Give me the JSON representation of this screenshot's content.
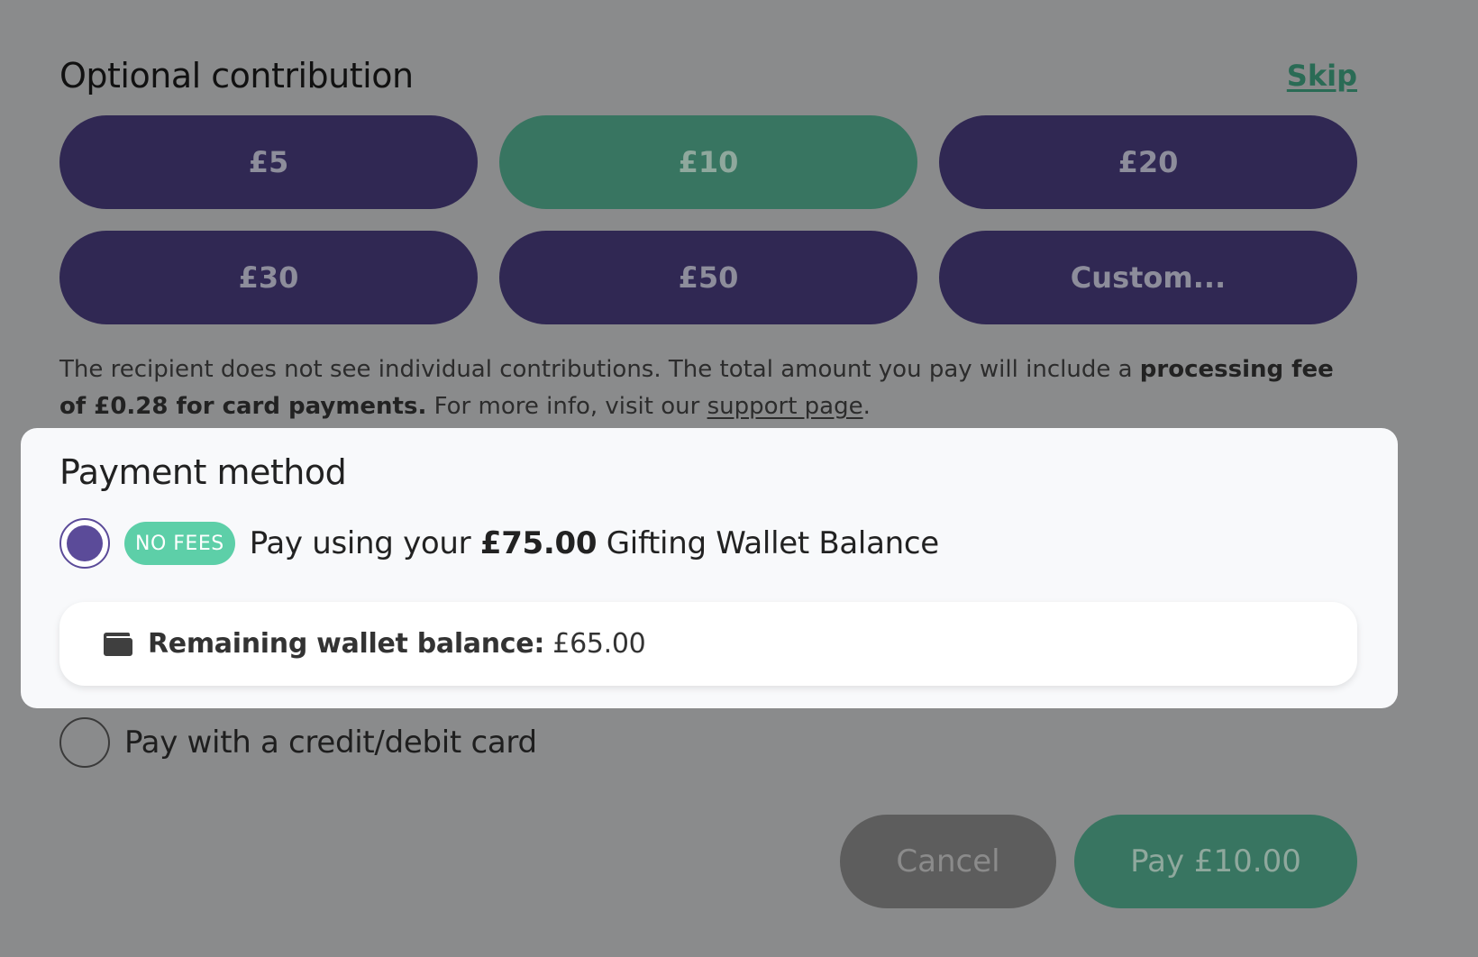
{
  "contribution": {
    "title": "Optional contribution",
    "skip_label": "Skip",
    "amounts": [
      {
        "label": "£5",
        "selected": false
      },
      {
        "label": "£10",
        "selected": true
      },
      {
        "label": "£20",
        "selected": false
      },
      {
        "label": "£30",
        "selected": false
      },
      {
        "label": "£50",
        "selected": false
      },
      {
        "label": "Custom...",
        "selected": false
      }
    ],
    "info": {
      "text_1": "The recipient does not see individual contributions. The total amount you pay will include a ",
      "fee_bold": "processing fee of £0.28 for card payments.",
      "text_2": " For more info, visit our ",
      "link_label": "support page",
      "text_3": "."
    }
  },
  "payment": {
    "title": "Payment method",
    "wallet_option": {
      "badge": "NO FEES",
      "label_prefix": "Pay using your ",
      "balance": "£75.00",
      "label_suffix": " Gifting Wallet Balance",
      "selected": true
    },
    "remaining": {
      "label": "Remaining wallet balance:",
      "value": "£65.00",
      "icon": "wallet-icon"
    },
    "card_option": {
      "label": "Pay with a credit/debit card",
      "selected": false
    }
  },
  "actions": {
    "cancel_label": "Cancel",
    "pay_label": "Pay £10.00"
  },
  "colors": {
    "overlay": "#8a8b8c",
    "primary_dark": "#302853",
    "selected_green": "#387561",
    "badge_green": "#5dcfa8",
    "radio_purple": "#5b4b99"
  }
}
